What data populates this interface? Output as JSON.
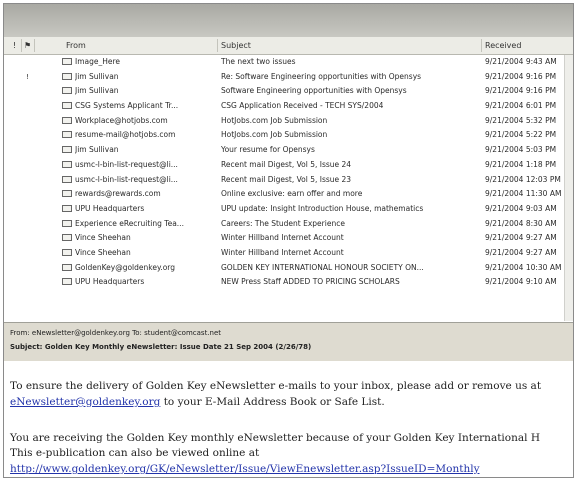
{
  "columns": {
    "importance": "!",
    "flag": "⚑",
    "from": "From",
    "subject": "Subject",
    "received": "Received"
  },
  "messages": [
    {
      "flag": "",
      "from": "Image_Here",
      "subject": "The next two issues",
      "received": "9/21/2004 9:43 AM"
    },
    {
      "flag": "!",
      "from": "Jim Sullivan",
      "subject": "Re: Software Engineering opportunities with Opensys",
      "received": "9/21/2004 9:16 PM"
    },
    {
      "flag": "",
      "from": "Jim Sullivan",
      "subject": "Software Engineering opportunities with Opensys",
      "received": "9/21/2004 9:16 PM"
    },
    {
      "flag": "",
      "from": "CSG Systems Applicant Tr...",
      "subject": "CSG Application Received - TECH SYS/2004",
      "received": "9/21/2004 6:01 PM"
    },
    {
      "flag": "",
      "from": "Workplace@hotjobs.com",
      "subject": "HotJobs.com Job Submission",
      "received": "9/21/2004 5:32 PM"
    },
    {
      "flag": "",
      "from": "resume-mail@hotjobs.com",
      "subject": "HotJobs.com Job Submission",
      "received": "9/21/2004 5:22 PM"
    },
    {
      "flag": "",
      "from": "Jim Sullivan",
      "subject": "Your resume for Opensys",
      "received": "9/21/2004 5:03 PM"
    },
    {
      "flag": "",
      "from": "usmc-l-bin-list-request@li...",
      "subject": "Recent mail Digest, Vol 5, Issue 24",
      "received": "9/21/2004 1:18 PM"
    },
    {
      "flag": "",
      "from": "usmc-l-bin-list-request@li...",
      "subject": "Recent mail Digest, Vol 5, Issue 23",
      "received": "9/21/2004 12:03 PM"
    },
    {
      "flag": "",
      "from": "rewards@rewards.com",
      "subject": "Online exclusive: earn offer and more",
      "received": "9/21/2004 11:30 AM"
    },
    {
      "flag": "",
      "from": "UPU Headquarters",
      "subject": "UPU update: Insight Introduction House, mathematics",
      "received": "9/21/2004 9:03 AM"
    },
    {
      "flag": "",
      "from": "Experience eRecruiting Tea...",
      "subject": "Careers: The Student Experience",
      "received": "9/21/2004 8:30 AM"
    },
    {
      "flag": "",
      "from": "Vince Sheehan",
      "subject": "Winter Hillband Internet Account",
      "received": "9/21/2004 9:27 AM"
    },
    {
      "flag": "",
      "from": "Vince Sheehan",
      "subject": "Winter Hillband Internet Account",
      "received": "9/21/2004 9:27 AM"
    },
    {
      "flag": "",
      "from": "GoldenKey@goldenkey.org",
      "subject": "GOLDEN KEY INTERNATIONAL HONOUR SOCIETY ON...",
      "received": "9/21/2004 10:30 AM"
    },
    {
      "flag": "",
      "from": "UPU Headquarters",
      "subject": "NEW Press Staff ADDED TO PRICING SCHOLARS",
      "received": "9/21/2004 9:10 AM"
    }
  ],
  "preview_header": {
    "from_line": "From:  eNewsletter@goldenkey.org    To:  student@comcast.net",
    "subject_line": "Subject:  Golden Key Monthly eNewsletter: Issue Date 21 Sep 2004 (2/26/78)"
  },
  "preview_body": {
    "line1": "To ensure the delivery of Golden Key eNewsletter e-mails to your inbox, please add or remove us at",
    "line2_link": "eNewsletter@goldenkey.org",
    "line2_rest": " to your E-Mail Address Book or Safe List.",
    "line3": "You are receiving the Golden Key monthly eNewsletter because of your Golden Key International H",
    "line4": "This e-publication can also be viewed online at",
    "line5_link": "http://www.goldenkey.org/GK/eNewsletter/Issue/ViewEnewsletter.asp?IssueID=Monthly"
  }
}
